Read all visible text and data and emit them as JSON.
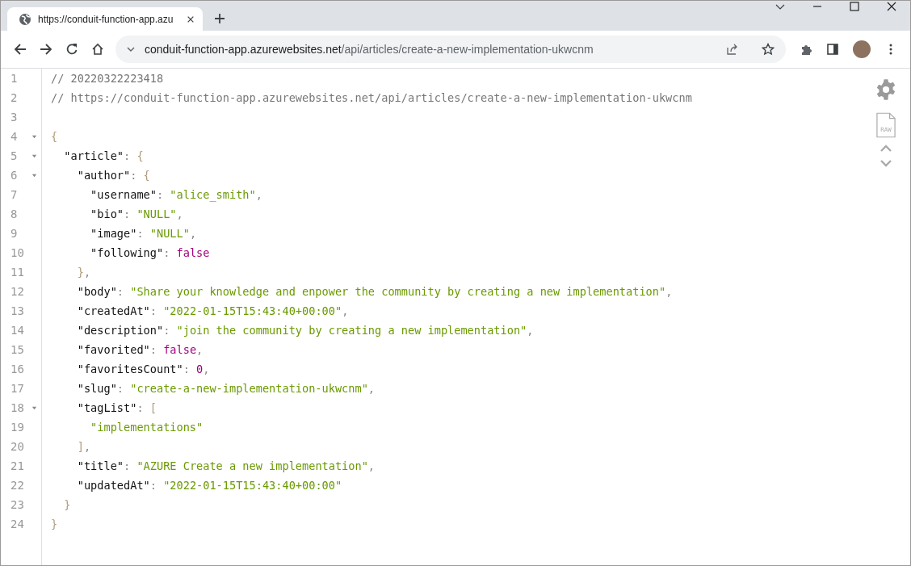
{
  "tab": {
    "title": "https://conduit-function-app.azu"
  },
  "address_bar": {
    "url_host": "conduit-function-app.azurewebsites.net",
    "url_path": "/api/articles/create-a-new-implementation-ukwcnm"
  },
  "viewer": {
    "raw_label": "RAW"
  },
  "lines": [
    {
      "number": "1",
      "fold": false,
      "tokens": [
        {
          "kind": "comment",
          "text": "// 20220322223418"
        }
      ]
    },
    {
      "number": "2",
      "fold": false,
      "tokens": [
        {
          "kind": "comment",
          "text": "// https://conduit-function-app.azurewebsites.net/api/articles/create-a-new-implementation-ukwcnm"
        }
      ]
    },
    {
      "number": "3",
      "fold": false
    },
    {
      "number": "4",
      "fold": true,
      "tokens": [
        {
          "kind": "brace",
          "text": "{"
        }
      ]
    },
    {
      "number": "5",
      "fold": true,
      "tokens": [
        {
          "kind": "key",
          "text": "  \"article\""
        },
        {
          "kind": "punct",
          "text": ": "
        },
        {
          "kind": "brace",
          "text": "{"
        }
      ]
    },
    {
      "number": "6",
      "fold": true,
      "tokens": [
        {
          "kind": "key",
          "text": "    \"author\""
        },
        {
          "kind": "punct",
          "text": ": "
        },
        {
          "kind": "brace",
          "text": "{"
        }
      ]
    },
    {
      "number": "7",
      "fold": false,
      "tokens": [
        {
          "kind": "key",
          "text": "      \"username\""
        },
        {
          "kind": "punct",
          "text": ": "
        },
        {
          "kind": "string",
          "text": "\"alice_smith\""
        },
        {
          "kind": "punct",
          "text": ","
        }
      ]
    },
    {
      "number": "8",
      "fold": false,
      "tokens": [
        {
          "kind": "key",
          "text": "      \"bio\""
        },
        {
          "kind": "punct",
          "text": ": "
        },
        {
          "kind": "string",
          "text": "\"NULL\""
        },
        {
          "kind": "punct",
          "text": ","
        }
      ]
    },
    {
      "number": "9",
      "fold": false,
      "tokens": [
        {
          "kind": "key",
          "text": "      \"image\""
        },
        {
          "kind": "punct",
          "text": ": "
        },
        {
          "kind": "string",
          "text": "\"NULL\""
        },
        {
          "kind": "punct",
          "text": ","
        }
      ]
    },
    {
      "number": "10",
      "fold": false,
      "tokens": [
        {
          "kind": "key",
          "text": "      \"following\""
        },
        {
          "kind": "punct",
          "text": ": "
        },
        {
          "kind": "literal",
          "text": "false"
        }
      ]
    },
    {
      "number": "11",
      "fold": false,
      "tokens": [
        {
          "kind": "brace",
          "text": "    }"
        },
        {
          "kind": "punct",
          "text": ","
        }
      ]
    },
    {
      "number": "12",
      "fold": false,
      "tokens": [
        {
          "kind": "key",
          "text": "    \"body\""
        },
        {
          "kind": "punct",
          "text": ": "
        },
        {
          "kind": "string",
          "text": "\"Share your knowledge and enpower the community by creating a new implementation\""
        },
        {
          "kind": "punct",
          "text": ","
        }
      ]
    },
    {
      "number": "13",
      "fold": false,
      "tokens": [
        {
          "kind": "key",
          "text": "    \"createdAt\""
        },
        {
          "kind": "punct",
          "text": ": "
        },
        {
          "kind": "string",
          "text": "\"2022-01-15T15:43:40+00:00\""
        },
        {
          "kind": "punct",
          "text": ","
        }
      ]
    },
    {
      "number": "14",
      "fold": false,
      "tokens": [
        {
          "kind": "key",
          "text": "    \"description\""
        },
        {
          "kind": "punct",
          "text": ": "
        },
        {
          "kind": "string",
          "text": "\"join the community by creating a new implementation\""
        },
        {
          "kind": "punct",
          "text": ","
        }
      ]
    },
    {
      "number": "15",
      "fold": false,
      "tokens": [
        {
          "kind": "key",
          "text": "    \"favorited\""
        },
        {
          "kind": "punct",
          "text": ": "
        },
        {
          "kind": "literal",
          "text": "false"
        },
        {
          "kind": "punct",
          "text": ","
        }
      ]
    },
    {
      "number": "16",
      "fold": false,
      "tokens": [
        {
          "kind": "key",
          "text": "    \"favoritesCount\""
        },
        {
          "kind": "punct",
          "text": ": "
        },
        {
          "kind": "literal",
          "text": "0"
        },
        {
          "kind": "punct",
          "text": ","
        }
      ]
    },
    {
      "number": "17",
      "fold": false,
      "tokens": [
        {
          "kind": "key",
          "text": "    \"slug\""
        },
        {
          "kind": "punct",
          "text": ": "
        },
        {
          "kind": "string",
          "text": "\"create-a-new-implementation-ukwcnm\""
        },
        {
          "kind": "punct",
          "text": ","
        }
      ]
    },
    {
      "number": "18",
      "fold": true,
      "tokens": [
        {
          "kind": "key",
          "text": "    \"tagList\""
        },
        {
          "kind": "punct",
          "text": ": "
        },
        {
          "kind": "brace",
          "text": "["
        }
      ]
    },
    {
      "number": "19",
      "fold": false,
      "tokens": [
        {
          "kind": "string",
          "text": "      \"implementations\""
        }
      ]
    },
    {
      "number": "20",
      "fold": false,
      "tokens": [
        {
          "kind": "brace",
          "text": "    ]"
        },
        {
          "kind": "punct",
          "text": ","
        }
      ]
    },
    {
      "number": "21",
      "fold": false,
      "tokens": [
        {
          "kind": "key",
          "text": "    \"title\""
        },
        {
          "kind": "punct",
          "text": ": "
        },
        {
          "kind": "string",
          "text": "\"AZURE Create a new implementation\""
        },
        {
          "kind": "punct",
          "text": ","
        }
      ]
    },
    {
      "number": "22",
      "fold": false,
      "tokens": [
        {
          "kind": "key",
          "text": "    \"updatedAt\""
        },
        {
          "kind": "punct",
          "text": ": "
        },
        {
          "kind": "string",
          "text": "\"2022-01-15T15:43:40+00:00\""
        }
      ]
    },
    {
      "number": "23",
      "fold": false,
      "tokens": [
        {
          "kind": "brace",
          "text": "  }"
        }
      ]
    },
    {
      "number": "24",
      "fold": false,
      "tokens": [
        {
          "kind": "brace",
          "text": "}"
        }
      ]
    }
  ]
}
